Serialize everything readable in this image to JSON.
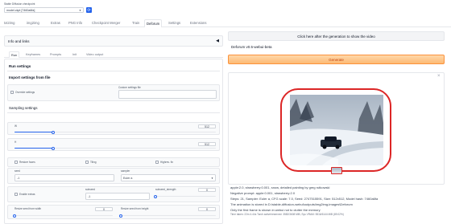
{
  "checkpoint": {
    "label": "Stable Diffusion checkpoint",
    "value": "model.ckpt [7460a6fa]"
  },
  "tabs": [
    "txt2img",
    "img2img",
    "Extras",
    "PNG Info",
    "Checkpoint Merger",
    "Train",
    "Deforum",
    "Settings",
    "Extensions"
  ],
  "active_tab": "Deforum",
  "left": {
    "info_header": "Info and links",
    "subtabs": [
      "Run",
      "Keyframes",
      "Prompts",
      "Init",
      "Video output"
    ],
    "run_settings": "Run settings",
    "import_title": "Import settings from file",
    "override_label": "Override settings",
    "custom_file_label": "Custom settings file",
    "sampling_title": "Sampling settings",
    "width": {
      "label": "W",
      "value": "512",
      "fraction": 0.19
    },
    "height": {
      "label": "H",
      "value": "512",
      "fraction": 0.19
    },
    "restore_faces": "Restore faces",
    "tiling": "Tiling",
    "highres": "Highres. fix",
    "seed": {
      "label": "seed",
      "value": "-1"
    },
    "sampler": {
      "label": "sampler",
      "value": "Euler a"
    },
    "enable_extras": "Enable extras",
    "subseed": {
      "label": "subseed",
      "value": "-1"
    },
    "subseed_strength": {
      "label": "subseed_strength",
      "value": "0",
      "fraction": 0.0
    },
    "resize_w": {
      "label": "Resize seed from width",
      "value": "0",
      "fraction": 0.0
    },
    "resize_h": {
      "label": "Resize seed from height",
      "value": "0",
      "fraction": 0.0
    }
  },
  "right": {
    "video_button": "Click here after the generation to show the video",
    "version": "Deforum v0.5-webui-beta",
    "generate": "Generate",
    "close": "×",
    "info_lines": [
      "apple:2.0, strawberry:0.001, snow, detailed painting by greg rutkowski",
      "Negative prompt: apple:0.001, strawberry:2.0",
      "Steps: 21, Sampler: Euler a, CFG scale: 7.0, Seed: 2747515591, Size: 512x512, Model hash: 7460a6fa",
      "The animation is stored in D:\\stable-diffusion-webui\\outputs/img2img-images\\Deforum",
      "Only the first frame is shown in webui not to clutter the memory"
    ],
    "time_line": "Time taken: 22m 4.44s  Torch active/reserved: 3582/3608 MiB, Sys VRAM: 5516/6144 MiB (89.02%)"
  },
  "colors": {
    "accent": "#2563eb",
    "generate_start": "#fed7aa",
    "generate_end": "#fdba74",
    "highlight": "#dc2626"
  }
}
